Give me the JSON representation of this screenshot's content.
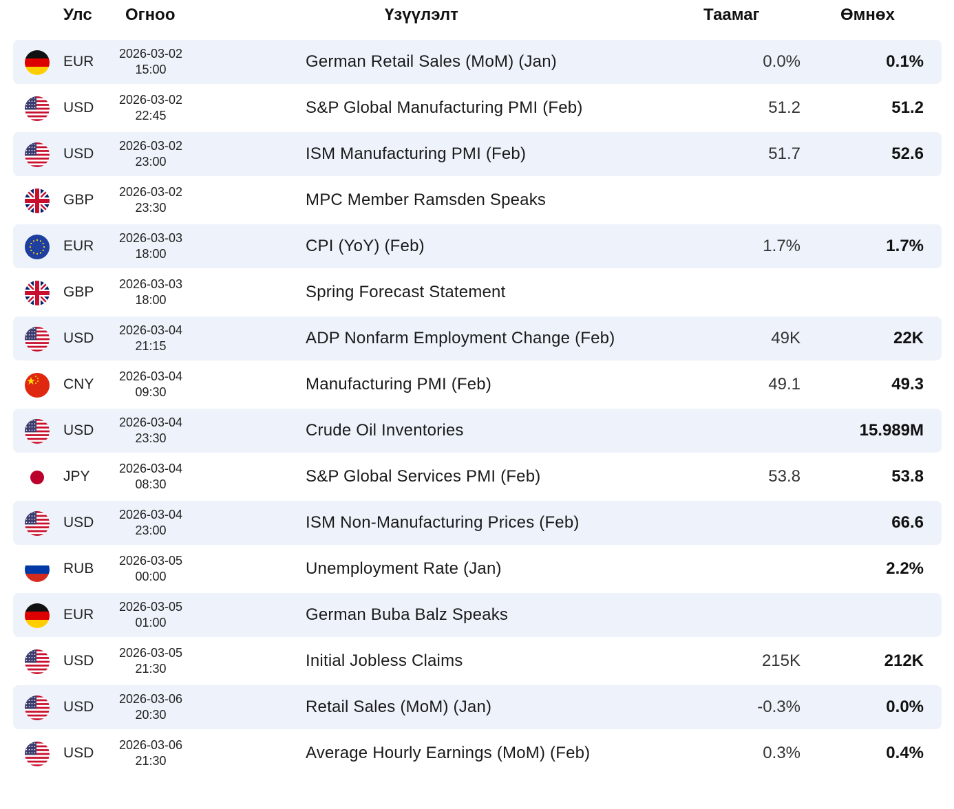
{
  "header": {
    "country": "Улс",
    "date": "Огноо",
    "event": "Үзүүлэлт",
    "forecast": "Таамаг",
    "previous": "Өмнөх"
  },
  "rows": [
    {
      "flag": "germany-flag-icon",
      "currency": "EUR",
      "date": "2026-03-02",
      "time": "15:00",
      "event": "German Retail Sales (MoM) (Jan)",
      "forecast": "0.0%",
      "previous": "0.1%"
    },
    {
      "flag": "usa-flag-icon",
      "currency": "USD",
      "date": "2026-03-02",
      "time": "22:45",
      "event": "S&P Global Manufacturing PMI (Feb)",
      "forecast": "51.2",
      "previous": "51.2"
    },
    {
      "flag": "usa-flag-icon",
      "currency": "USD",
      "date": "2026-03-02",
      "time": "23:00",
      "event": "ISM Manufacturing PMI (Feb)",
      "forecast": "51.7",
      "previous": "52.6"
    },
    {
      "flag": "uk-flag-icon",
      "currency": "GBP",
      "date": "2026-03-02",
      "time": "23:30",
      "event": "MPC Member Ramsden Speaks",
      "forecast": "",
      "previous": ""
    },
    {
      "flag": "eu-flag-icon",
      "currency": "EUR",
      "date": "2026-03-03",
      "time": "18:00",
      "event": "CPI (YoY) (Feb)",
      "forecast": "1.7%",
      "previous": "1.7%"
    },
    {
      "flag": "uk-flag-icon",
      "currency": "GBP",
      "date": "2026-03-03",
      "time": "18:00",
      "event": "Spring Forecast Statement",
      "forecast": "",
      "previous": ""
    },
    {
      "flag": "usa-flag-icon",
      "currency": "USD",
      "date": "2026-03-04",
      "time": "21:15",
      "event": "ADP Nonfarm Employment Change (Feb)",
      "forecast": "49K",
      "previous": "22K"
    },
    {
      "flag": "china-flag-icon",
      "currency": "CNY",
      "date": "2026-03-04",
      "time": "09:30",
      "event": "Manufacturing PMI (Feb)",
      "forecast": "49.1",
      "previous": "49.3"
    },
    {
      "flag": "usa-flag-icon",
      "currency": "USD",
      "date": "2026-03-04",
      "time": "23:30",
      "event": "Crude Oil Inventories",
      "forecast": "",
      "previous": "15.989M"
    },
    {
      "flag": "japan-flag-icon",
      "currency": "JPY",
      "date": "2026-03-04",
      "time": "08:30",
      "event": "S&P Global Services PMI (Feb)",
      "forecast": "53.8",
      "previous": "53.8"
    },
    {
      "flag": "usa-flag-icon",
      "currency": "USD",
      "date": "2026-03-04",
      "time": "23:00",
      "event": "ISM Non-Manufacturing Prices (Feb)",
      "forecast": "",
      "previous": "66.6"
    },
    {
      "flag": "russia-flag-icon",
      "currency": "RUB",
      "date": "2026-03-05",
      "time": "00:00",
      "event": "Unemployment Rate (Jan)",
      "forecast": "",
      "previous": "2.2%"
    },
    {
      "flag": "germany-flag-icon",
      "currency": "EUR",
      "date": "2026-03-05",
      "time": "01:00",
      "event": "German Buba Balz Speaks",
      "forecast": "",
      "previous": ""
    },
    {
      "flag": "usa-flag-icon",
      "currency": "USD",
      "date": "2026-03-05",
      "time": "21:30",
      "event": "Initial Jobless Claims",
      "forecast": "215K",
      "previous": "212K"
    },
    {
      "flag": "usa-flag-icon",
      "currency": "USD",
      "date": "2026-03-06",
      "time": "20:30",
      "event": "Retail Sales (MoM) (Jan)",
      "forecast": "-0.3%",
      "previous": "0.0%"
    },
    {
      "flag": "usa-flag-icon",
      "currency": "USD",
      "date": "2026-03-06",
      "time": "21:30",
      "event": "Average Hourly Earnings (MoM) (Feb)",
      "forecast": "0.3%",
      "previous": "0.4%"
    }
  ]
}
